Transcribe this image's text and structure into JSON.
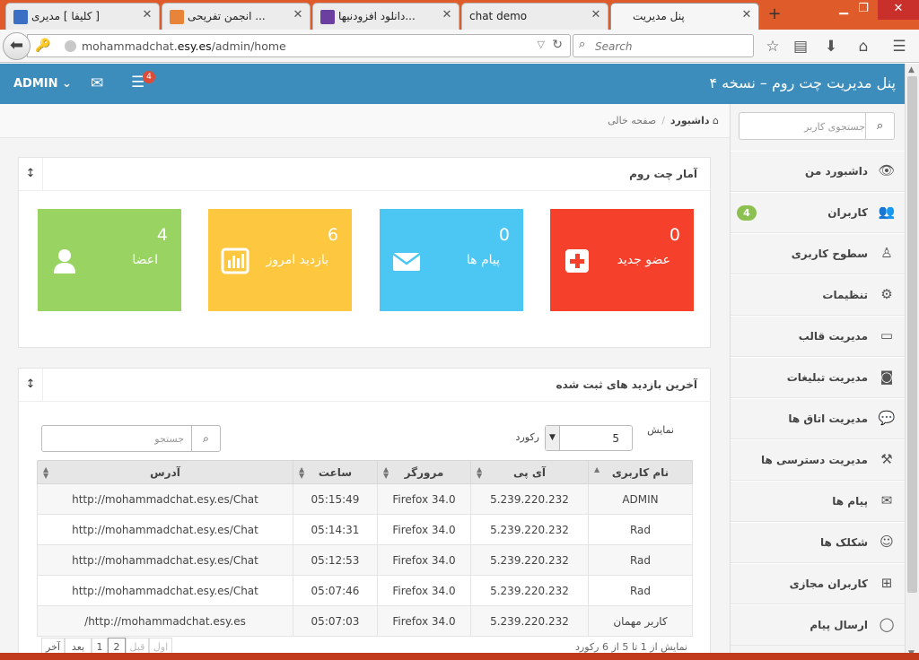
{
  "browser": {
    "tabs": [
      {
        "title": "کلیفا ] مدیری ]",
        "favicon_color": "#3b6fc4"
      },
      {
        "title": "انجمن تفریحی ...",
        "favicon_color": "#e8833a"
      },
      {
        "title": "دانلود افزودنیها...",
        "favicon_color": "#6b3fa0"
      },
      {
        "title": "chat demo",
        "favicon_color": ""
      },
      {
        "title": "پنل مدیریت",
        "favicon_color": ""
      }
    ],
    "new_tab": "+",
    "url_host": "mohammadchat.",
    "url_domain": "esy.es",
    "url_path": "/admin/home",
    "search_placeholder": "Search"
  },
  "header": {
    "brand": "پنل مدیریت چت روم – نسخه ۴",
    "admin_label": "ADMIN",
    "notification_count": "4"
  },
  "sidebar": {
    "search_placeholder": "جستجوی کاربر",
    "items": [
      {
        "label": "داشبورد من",
        "icon": "eye-icon",
        "glyph": "👁"
      },
      {
        "label": "کاربران",
        "icon": "users-icon",
        "glyph": "👥",
        "count": "4"
      },
      {
        "label": "سطوح کاربری",
        "icon": "user-levels-icon",
        "glyph": "♙"
      },
      {
        "label": "تنظیمات",
        "icon": "gears-icon",
        "glyph": "⚙"
      },
      {
        "label": "مدیریت قالب",
        "icon": "monitor-icon",
        "glyph": "▭"
      },
      {
        "label": "مدیریت تبلیغات",
        "icon": "camera-icon",
        "glyph": "◙"
      },
      {
        "label": "مدیریت اتاق ها",
        "icon": "comments-icon",
        "glyph": "💬"
      },
      {
        "label": "مدیریت دسترسی ها",
        "icon": "gavel-icon",
        "glyph": "⚒"
      },
      {
        "label": "پیام ها",
        "icon": "envelope-icon",
        "glyph": "✉"
      },
      {
        "label": "شکلک ها",
        "icon": "smile-icon",
        "glyph": "☺"
      },
      {
        "label": "کاربران مجازی",
        "icon": "plus-square-icon",
        "glyph": "⊞"
      },
      {
        "label": "ارسال پیام",
        "icon": "comment-icon",
        "glyph": "◯"
      }
    ]
  },
  "breadcrumb": {
    "home": "داشبورد",
    "current": "صفحه خالی"
  },
  "stats": {
    "title": "آمار چت روم",
    "tiles": [
      {
        "value": "0",
        "label": "عضو جدید",
        "color": "#f5412c",
        "icon": "plus-square-icon"
      },
      {
        "value": "0",
        "label": "پیام ها",
        "color": "#4cc6f2",
        "icon": "envelope-icon"
      },
      {
        "value": "6",
        "label": "بازدید امروز",
        "color": "#fec740",
        "icon": "bar-chart-icon"
      },
      {
        "value": "4",
        "label": "اعضا",
        "color": "#99d463",
        "icon": "user-icon"
      }
    ]
  },
  "visits": {
    "title": "آخرین بازدید های ثبت شده",
    "show_label": "نمایش",
    "page_size": "5",
    "records_label": "رکورد",
    "search_placeholder": "جستجو",
    "columns": [
      "نام کاربری",
      "آی پی",
      "مرورگر",
      "ساعت",
      "آدرس"
    ],
    "rows": [
      [
        "ADMIN",
        "5.239.220.232",
        "Firefox 34.0",
        "05:15:49",
        "http://mohammadchat.esy.es/Chat"
      ],
      [
        "Rad",
        "5.239.220.232",
        "Firefox 34.0",
        "05:14:31",
        "http://mohammadchat.esy.es/Chat"
      ],
      [
        "Rad",
        "5.239.220.232",
        "Firefox 34.0",
        "05:12:53",
        "http://mohammadchat.esy.es/Chat"
      ],
      [
        "Rad",
        "5.239.220.232",
        "Firefox 34.0",
        "05:07:46",
        "http://mohammadchat.esy.es/Chat"
      ],
      [
        "کاربر مهمان",
        "5.239.220.232",
        "Firefox 34.0",
        "05:07:03",
        "http://mohammadchat.esy.es/"
      ]
    ],
    "pagination": [
      "آخر",
      "بعد",
      "1",
      "2",
      "قبل",
      "اول"
    ],
    "page_info": "نمایش از 1 تا 5 از 6 رکورد"
  }
}
